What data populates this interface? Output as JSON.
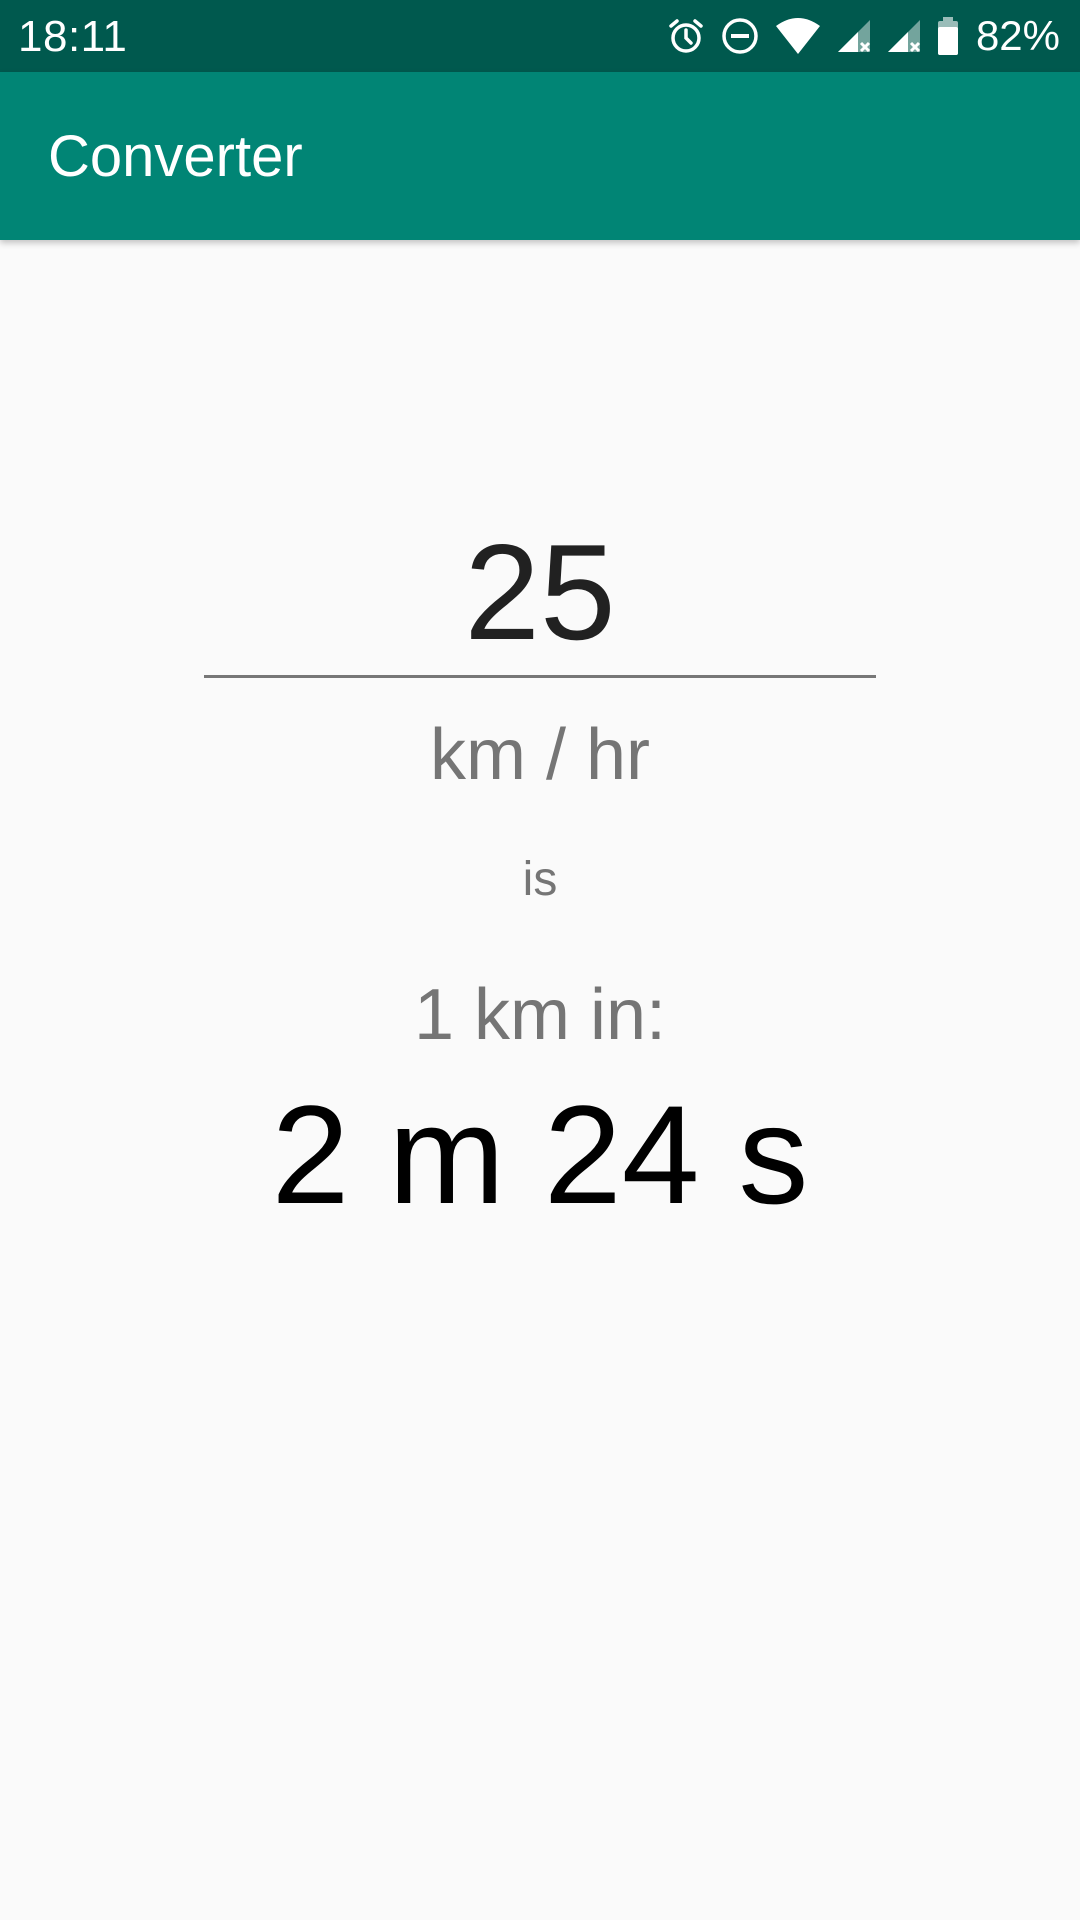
{
  "status_bar": {
    "time": "18:11",
    "battery_percent": "82%",
    "icons": [
      "alarm-icon",
      "do-not-disturb-icon",
      "wifi-icon",
      "cell-signal-no-data-icon",
      "cell-signal-no-data-icon",
      "battery-icon"
    ]
  },
  "app_bar": {
    "title": "Converter"
  },
  "converter": {
    "speed_value": "25",
    "speed_unit": "km / hr",
    "connector": "is",
    "distance_label": "1 km in:",
    "result": "2 m 24 s"
  },
  "colors": {
    "status_bar": "#00594e",
    "app_bar": "#018575",
    "background": "#fafafa",
    "secondary_text": "#757575",
    "primary_text": "#212121"
  }
}
